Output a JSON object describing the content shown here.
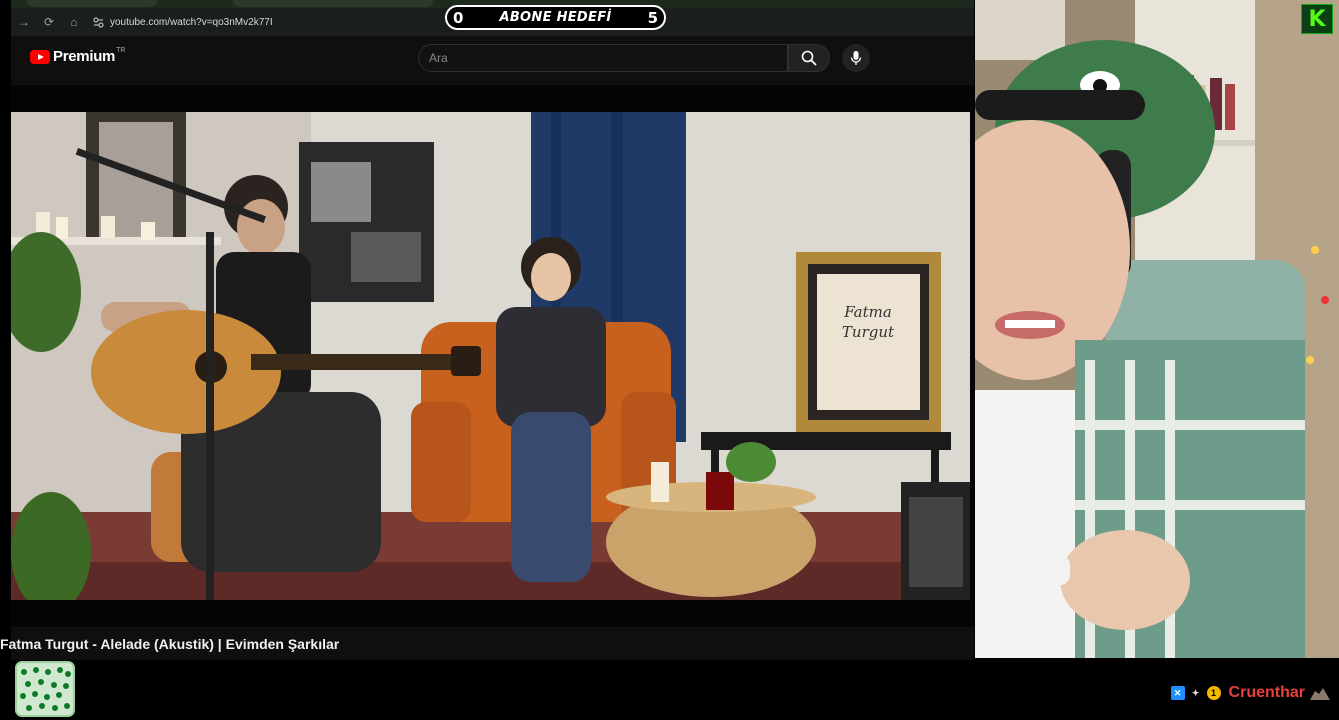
{
  "browser": {
    "url": "youtube.com/watch?v=qo3nMv2k77I",
    "nav": {
      "back": "→",
      "reload": "⟳",
      "home": "⌂"
    }
  },
  "goal": {
    "current": "0",
    "label": "ABONE HEDEFİ",
    "target": "5"
  },
  "youtube": {
    "logo_text": "Premium",
    "country_code": "TR",
    "search_placeholder": "Ara"
  },
  "video": {
    "title": "Fatma Turgut - Alelade (Akustik) | Evimden Şarkılar",
    "frame_sign_line1": "Fatma",
    "frame_sign_line2": "Turgut"
  },
  "stream": {
    "platform_logo": "K",
    "username": "Cruenthar",
    "badge_number": "1",
    "colors": {
      "username": "#e8403f",
      "kick_green": "#53fc18"
    }
  },
  "icons": [
    "forward-icon",
    "reload-icon",
    "home-icon",
    "site-settings-icon",
    "search-icon",
    "mic-icon",
    "kick-logo",
    "badge-icon",
    "number-badge-icon",
    "rock-emote-icon",
    "cup-emote-icon"
  ]
}
